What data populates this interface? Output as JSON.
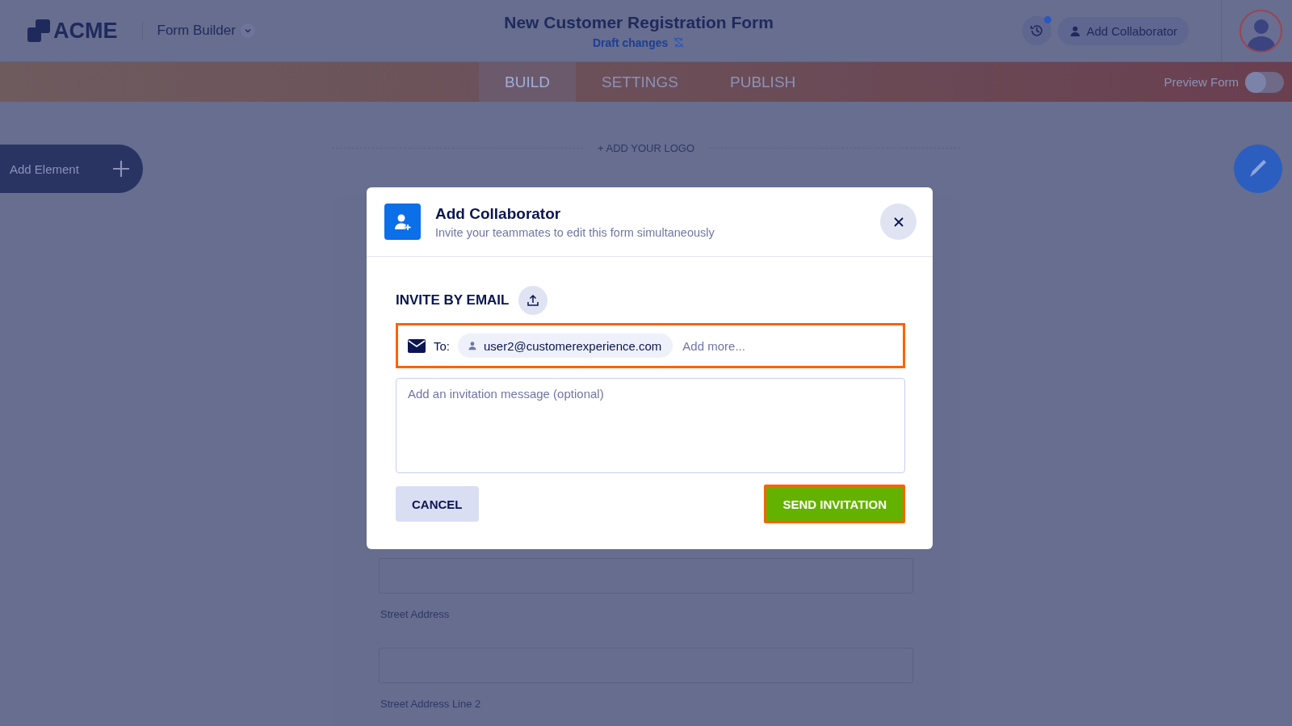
{
  "header": {
    "logo": "ACME",
    "app_menu": "Form Builder",
    "title": "New Customer Registration Form",
    "status": "Draft changes",
    "history_badge": true,
    "collaborator_button": "Add Collaborator"
  },
  "tabs": [
    {
      "label": "BUILD",
      "selected": true
    },
    {
      "label": "SETTINGS",
      "selected": false
    },
    {
      "label": "PUBLISH",
      "selected": false
    }
  ],
  "preview": {
    "label": "Preview Form",
    "on": false
  },
  "canvas": {
    "add_element": "Add Element",
    "add_logo": "+ ADD YOUR LOGO",
    "fields": [
      {
        "label": "Street Address"
      },
      {
        "label": "Street Address Line 2"
      }
    ]
  },
  "dialog": {
    "title": "Add Collaborator",
    "subtitle": "Invite your teammates to edit this form simultaneously",
    "section": "INVITE BY EMAIL",
    "to_label": "To:",
    "recipients": [
      "user2@customerexperience.com"
    ],
    "add_more_placeholder": "Add more...",
    "message_placeholder": "Add an invitation message (optional)",
    "cancel": "CANCEL",
    "send": "SEND INVITATION"
  }
}
